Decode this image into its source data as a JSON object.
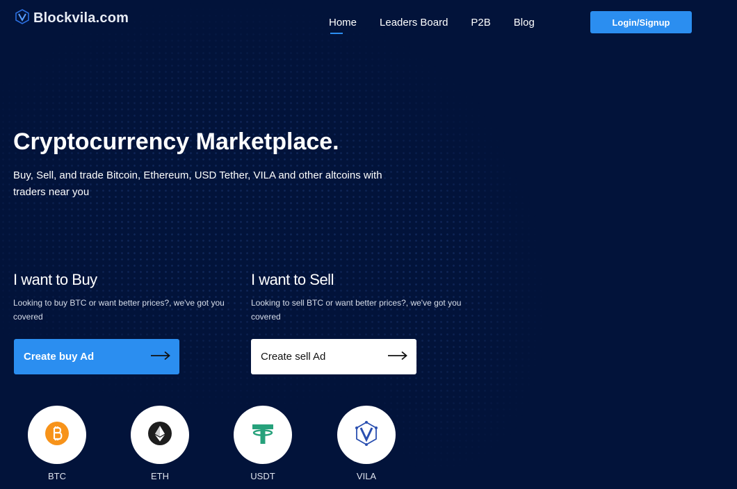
{
  "header": {
    "logo_text": "Blockvila.com",
    "nav": [
      {
        "label": "Home",
        "active": true
      },
      {
        "label": "Leaders Board",
        "active": false
      },
      {
        "label": "P2B",
        "active": false
      },
      {
        "label": "Blog",
        "active": false
      }
    ],
    "login_label": "Login/Signup"
  },
  "hero": {
    "title": "Cryptocurrency Marketplace.",
    "subtitle": "Buy, Sell, and trade Bitcoin, Ethereum, USD Tether, VILA and other altcoins with traders near you"
  },
  "buy": {
    "title": "I want to Buy",
    "description": "Looking to buy BTC or want better prices?, we've got you covered",
    "button_label": "Create buy Ad"
  },
  "sell": {
    "title": "I want to Sell",
    "description": "Looking to sell BTC or want better prices?, we've got you covered",
    "button_label": "Create sell Ad"
  },
  "coins": [
    {
      "label": "BTC",
      "icon": "bitcoin-icon",
      "color": "#f7931a"
    },
    {
      "label": "ETH",
      "icon": "ethereum-icon",
      "color": "#1e1e1e"
    },
    {
      "label": "USDT",
      "icon": "tether-icon",
      "color": "#26a17b"
    },
    {
      "label": "VILA",
      "icon": "vila-icon",
      "color": "#2a4fb0"
    }
  ],
  "colors": {
    "background": "#02133a",
    "accent": "#2b8ef0"
  }
}
